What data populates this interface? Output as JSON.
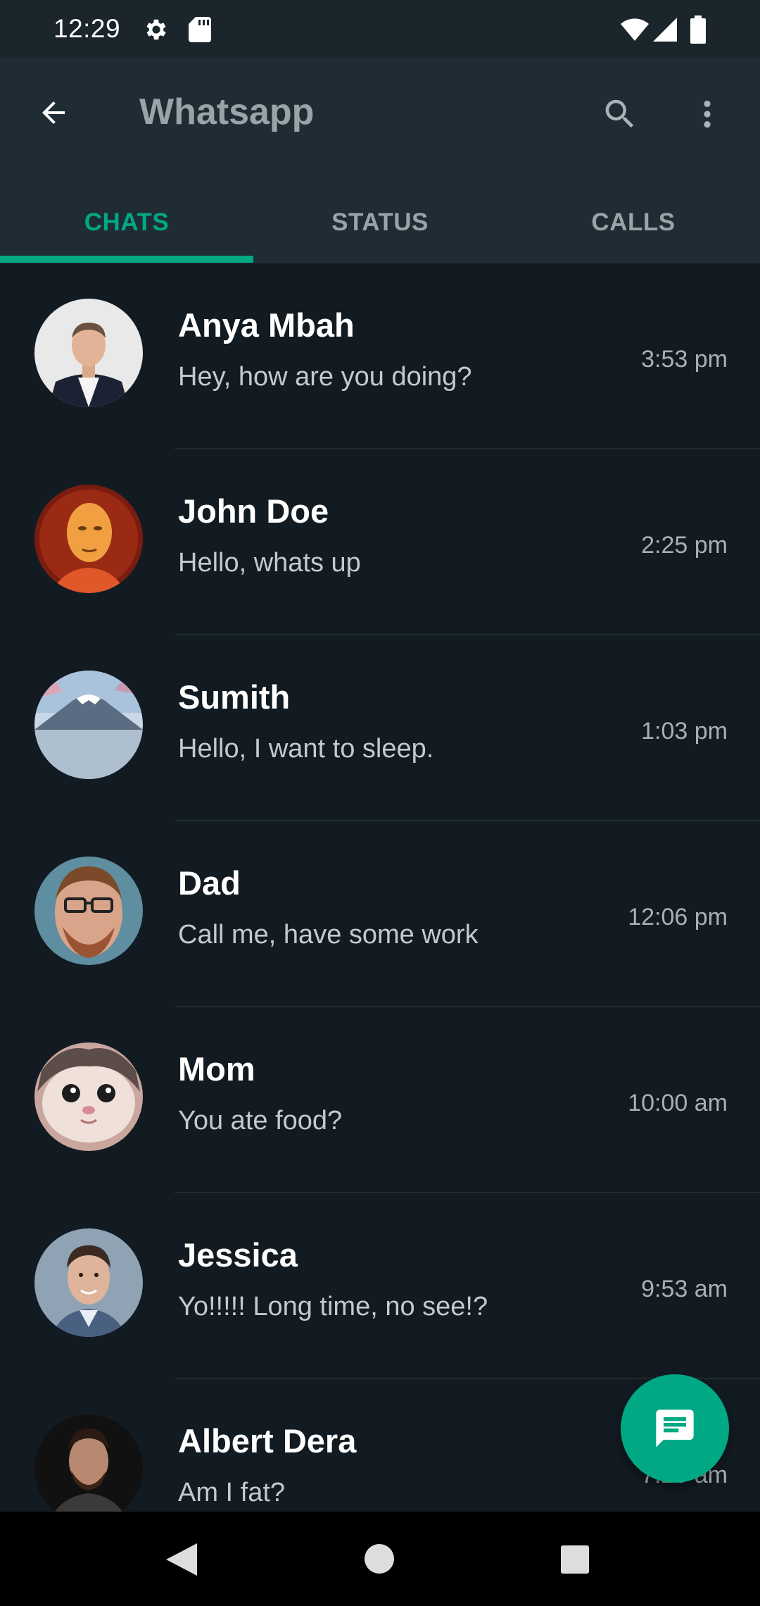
{
  "status_bar": {
    "time": "12:29",
    "icons": [
      "gear-icon",
      "sd-card-icon",
      "wifi-icon",
      "signal-icon",
      "battery-icon"
    ]
  },
  "app_bar": {
    "title": "Whatsapp",
    "back_icon": "arrow-back-icon",
    "search_icon": "search-icon",
    "menu_icon": "more-vert-icon"
  },
  "tabs": [
    {
      "label": "CHATS",
      "active": true
    },
    {
      "label": "STATUS",
      "active": false
    },
    {
      "label": "CALLS",
      "active": false
    }
  ],
  "chats": [
    {
      "name": "Anya Mbah",
      "message": "Hey, how are you doing?",
      "time": "3:53 pm"
    },
    {
      "name": "John Doe",
      "message": "Hello, whats up",
      "time": "2:25 pm"
    },
    {
      "name": "Sumith",
      "message": "Hello, I want to sleep.",
      "time": "1:03 pm"
    },
    {
      "name": "Dad",
      "message": "Call me, have some work",
      "time": "12:06 pm"
    },
    {
      "name": "Mom",
      "message": "You ate food?",
      "time": "10:00 am"
    },
    {
      "name": "Jessica",
      "message": "Yo!!!!! Long time, no see!?",
      "time": "9:53 am"
    },
    {
      "name": "Albert Dera",
      "message": "Am I fat?",
      "time": "7:20 am"
    }
  ],
  "fab": {
    "icon": "chat-message-icon"
  },
  "colors": {
    "accent": "#00a884",
    "background": "#121b22",
    "app_bar": "#1f2c34",
    "title_text": "#9aa3a8"
  }
}
